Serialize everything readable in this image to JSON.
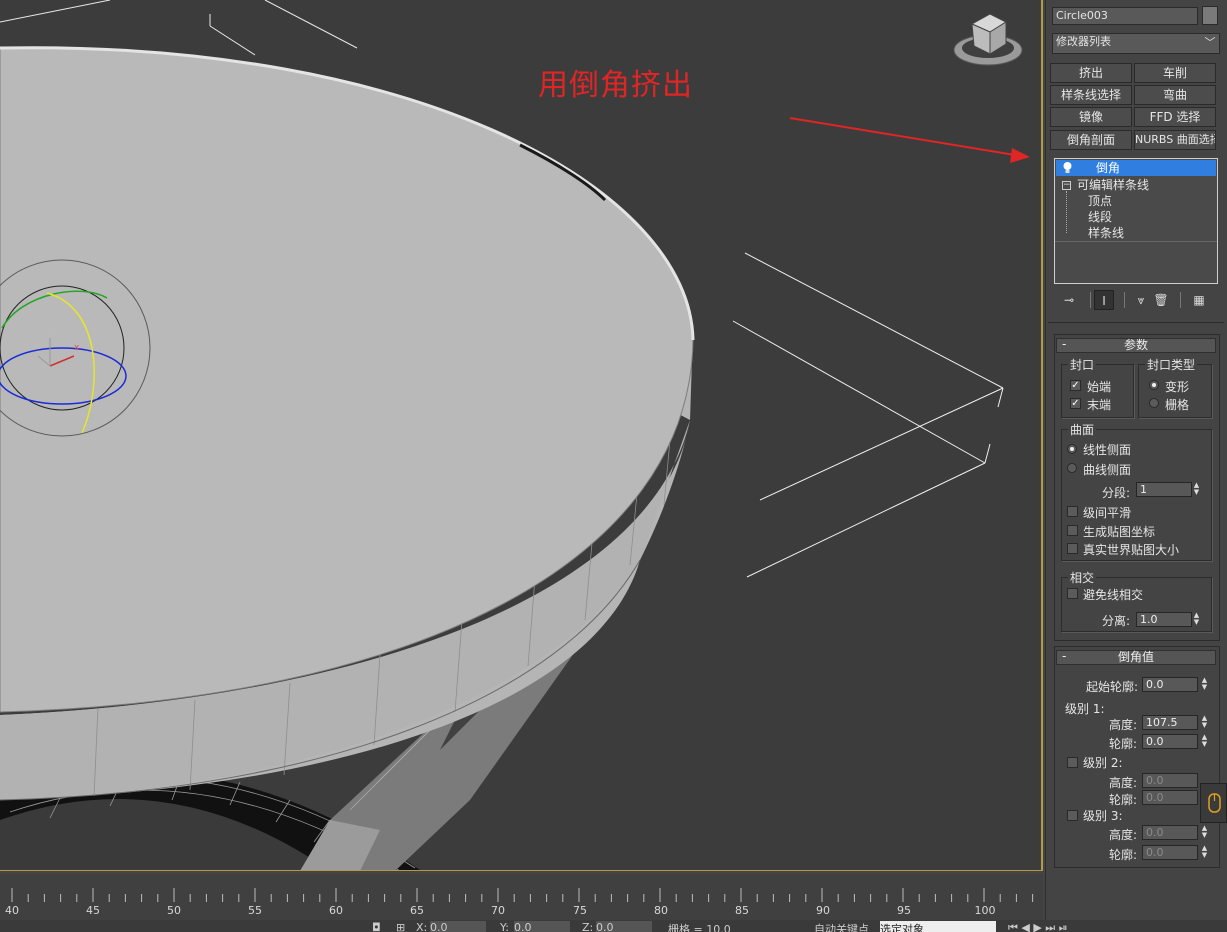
{
  "annotation": {
    "text": "用倒角挤出",
    "color": "#e02525"
  },
  "object": {
    "name": "Circle003"
  },
  "modifier_list": {
    "label": "修改器列表"
  },
  "modifier_buttons": [
    {
      "label": "挤出"
    },
    {
      "label": "车削"
    },
    {
      "label": "样条线选择"
    },
    {
      "label": "弯曲"
    },
    {
      "label": "镜像"
    },
    {
      "label": "FFD 选择"
    },
    {
      "label": "倒角剖面"
    },
    {
      "label": "NURBS 曲面选择"
    }
  ],
  "stack": {
    "selected": "倒角",
    "base": "可编辑样条线",
    "subobjects": [
      "顶点",
      "线段",
      "样条线"
    ]
  },
  "params": {
    "title": "参数",
    "cap_group": "封口",
    "cap_start": "始端",
    "cap_end": "末端",
    "cap_type_group": "封口类型",
    "morph": "变形",
    "grid": "栅格",
    "surface_group": "曲面",
    "linear_sides": "线性侧面",
    "curved_sides": "曲线侧面",
    "segments_label": "分段:",
    "segments_value": "1",
    "smooth_across": "级间平滑",
    "gen_mapping": "生成贴图坐标",
    "real_world": "真实世界贴图大小",
    "intersect_group": "相交",
    "keep_lines": "避免线相交",
    "separation_label": "分离:",
    "separation_value": "1.0"
  },
  "bevel_values": {
    "title": "倒角值",
    "start_outline_label": "起始轮廓:",
    "start_outline_value": "0.0",
    "level1_label": "级别 1:",
    "height_label": "高度:",
    "outline_label": "轮廓:",
    "level1_height": "107.5",
    "level1_outline": "0.0",
    "level2_label": "级别 2:",
    "level2_height": "0.0",
    "level2_outline": "0.0",
    "level3_label": "级别 3:",
    "level3_height": "0.0",
    "level3_outline": "0.0"
  },
  "timeline": {
    "ticks": [
      "40",
      "45",
      "50",
      "55",
      "60",
      "65",
      "70",
      "75",
      "80",
      "85",
      "90",
      "95",
      "100"
    ]
  },
  "statusbar": {
    "x_label": "X:",
    "x_value": "0.0",
    "y_label": "Y:",
    "y_value": "0.0",
    "z_label": "Z:",
    "z_value": "0.0",
    "grid_label": "栅格 = 10.0",
    "autokey_label": "自动关键点",
    "selection_label": "选定对象"
  },
  "gizmo_axes": {
    "x": "x",
    "y": "y",
    "z": "z"
  },
  "colors": {
    "viewport_border": "#b39a45",
    "selection": "#2f7ee0",
    "arrow": "#e02525"
  }
}
